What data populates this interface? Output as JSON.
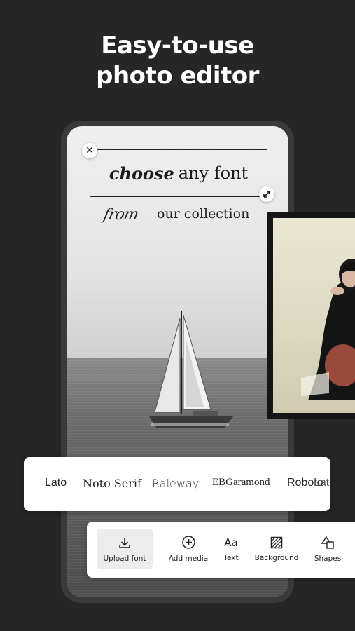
{
  "headline": {
    "line1": "Easy-to-use",
    "line2": "photo editor"
  },
  "editor": {
    "font_title_italic": "choose",
    "font_title_rest": "any font",
    "subtitle_script": "from",
    "subtitle_rest": "our collection"
  },
  "font_options": [
    "Lato",
    "Noto Serif",
    "Raleway",
    "EBGaramond",
    "Roboto",
    "Lato"
  ],
  "toolbar": {
    "upload_font": "Upload font",
    "add_media": "Add media",
    "text": "Text",
    "text_icon": "Aa",
    "background": "Background",
    "shapes": "Shapes"
  },
  "icons": [
    "close-icon",
    "resize-icon",
    "download-icon",
    "plus-circle-icon",
    "text-icon",
    "background-icon",
    "shapes-icon"
  ],
  "colors": {
    "background": "#262626",
    "panel": "#ffffff",
    "selected_tool": "#ececec"
  }
}
